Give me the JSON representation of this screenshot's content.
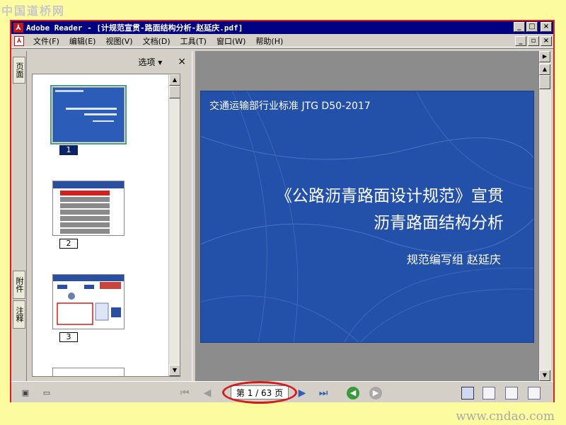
{
  "watermarks": {
    "top": "中国道桥网",
    "bottom": "www.cndao.com"
  },
  "titlebar": {
    "title": "Adobe Reader - [计规范宣贯-路面结构分析-赵延庆.pdf]",
    "controls": [
      "_",
      "□",
      "×"
    ]
  },
  "menubar": {
    "items": [
      "文件(F)",
      "编辑(E)",
      "视图(V)",
      "文档(D)",
      "工具(T)",
      "窗口(W)",
      "帮助(H)"
    ],
    "controls": [
      "_",
      "▫",
      "×"
    ]
  },
  "left_tabs": {
    "pages": "页面",
    "attachments": "附件",
    "comments": "注释"
  },
  "panel": {
    "options_label": "选项 ▾",
    "close_label": "×",
    "thumbnails": [
      {
        "number": "1",
        "selected": true
      },
      {
        "number": "2",
        "selected": false
      },
      {
        "number": "3",
        "selected": false
      }
    ]
  },
  "slide": {
    "standard": "交通运输部行业标准  JTG D50-2017",
    "title_line1": "《公路沥青路面设计规范》宣贯",
    "title_line2": "沥青路面结构分析",
    "author": "规范编写组  赵延庆"
  },
  "status": {
    "page_display": "第 1 / 63 页",
    "current_page": 1,
    "total_pages": 63
  },
  "colors": {
    "slide_bg": "#2350a8",
    "titlebar": "#000080",
    "annotation_red": "#d41a1a",
    "frame_red": "#e11d1d",
    "page_bg": "#fcfba0"
  }
}
